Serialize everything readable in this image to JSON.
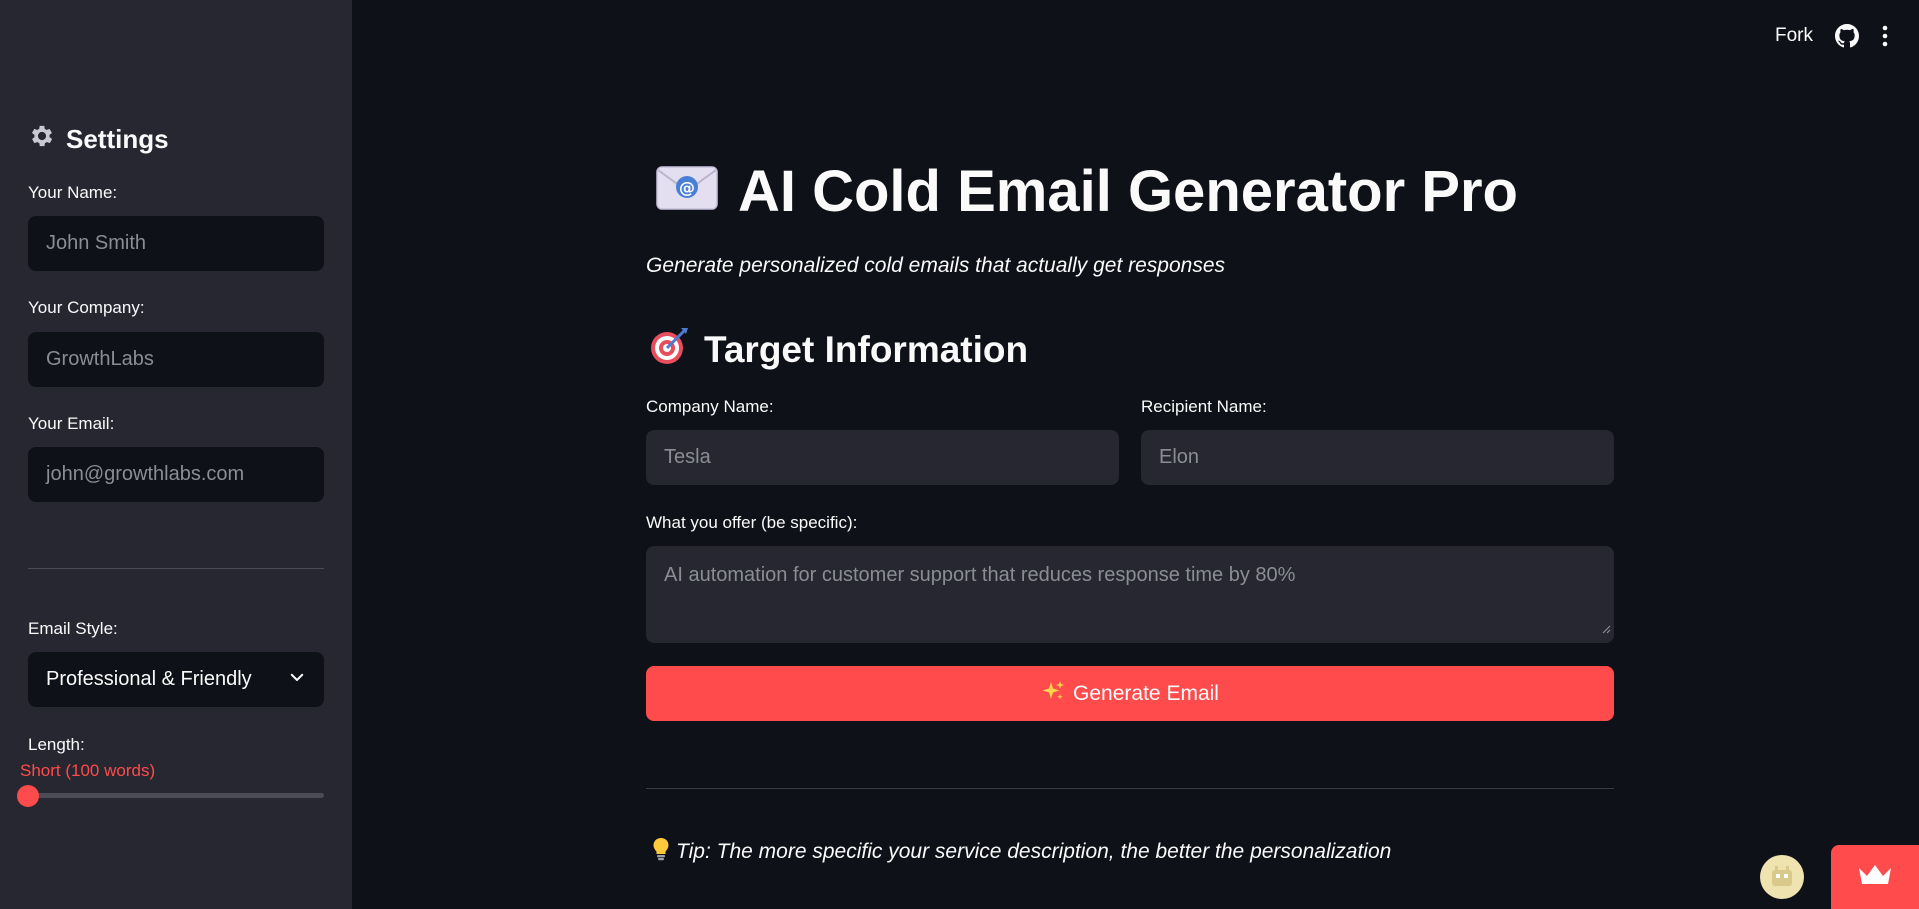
{
  "header": {
    "fork_label": "Fork"
  },
  "sidebar": {
    "title": "Settings",
    "your_name": {
      "label": "Your Name:",
      "placeholder": "John Smith"
    },
    "your_company": {
      "label": "Your Company:",
      "placeholder": "GrowthLabs"
    },
    "your_email": {
      "label": "Your Email:",
      "placeholder": "john@growthlabs.com"
    },
    "email_style": {
      "label": "Email Style:",
      "value": "Professional & Friendly"
    },
    "length": {
      "label": "Length:",
      "value": "Short (100 words)",
      "fraction": 0
    }
  },
  "main": {
    "title": "AI Cold Email Generator Pro",
    "subtitle": "Generate personalized cold emails that actually get responses",
    "section_title": "Target Information",
    "company_name": {
      "label": "Company Name:",
      "placeholder": "Tesla"
    },
    "recipient_name": {
      "label": "Recipient Name:",
      "placeholder": "Elon"
    },
    "offer": {
      "label": "What you offer (be specific):",
      "placeholder": "AI automation for customer support that reduces response time by 80%"
    },
    "generate_button": "Generate Email",
    "tip": "Tip: The more specific your service description, the better the personalization"
  },
  "colors": {
    "accent": "#ff4b4b",
    "background": "#0e1117",
    "sidebar": "#262730"
  },
  "icons": [
    "gear-icon",
    "github-icon",
    "kebab-menu-icon",
    "email-icon",
    "target-icon",
    "chevron-down-icon",
    "sparkles-icon",
    "lightbulb-icon",
    "crown-icon"
  ]
}
